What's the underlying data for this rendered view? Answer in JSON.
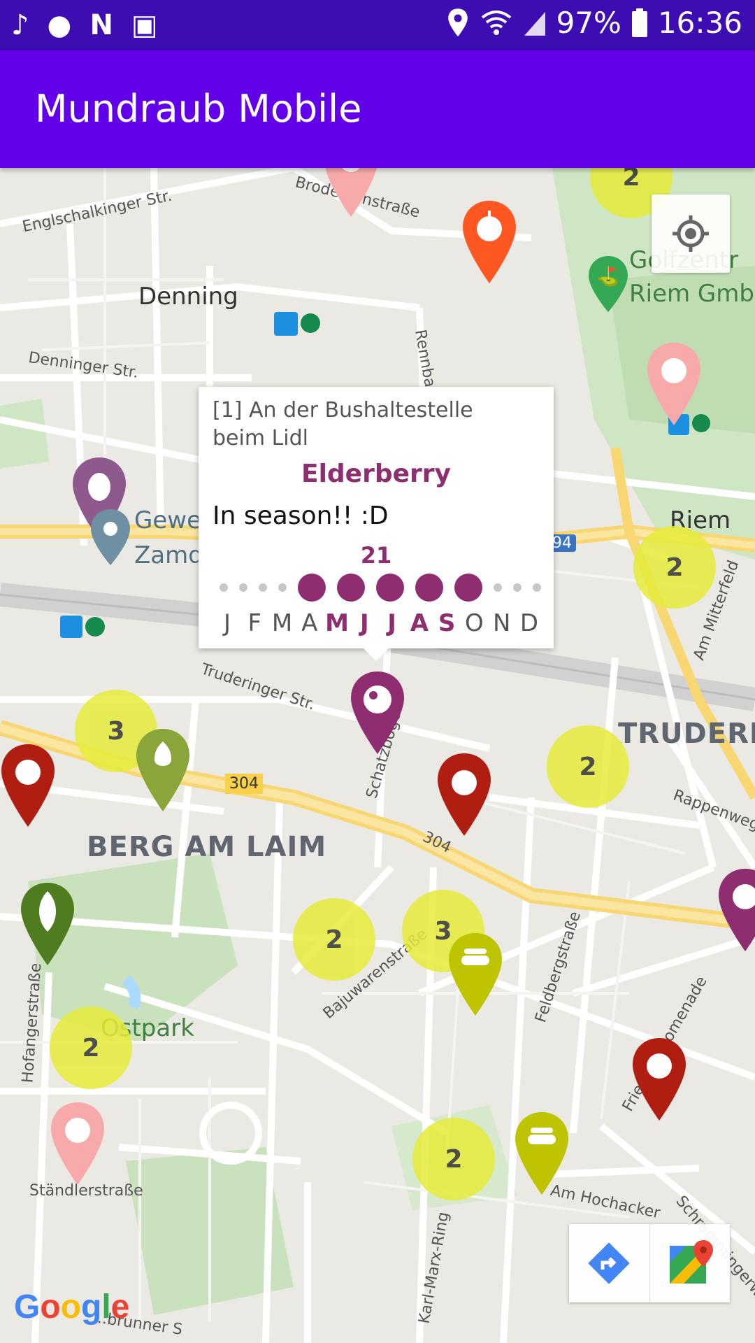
{
  "status_bar": {
    "battery": "97%",
    "time": "16:36",
    "left_icons": [
      "music-note-icon",
      "lightbulb-icon",
      "netflix-icon",
      "gallery-icon"
    ],
    "right_icons": [
      "location-icon",
      "wifi-icon",
      "signal-icon",
      "battery-icon"
    ]
  },
  "app_bar": {
    "title": "Mundraub Mobile"
  },
  "map": {
    "labels": {
      "englschalkinger": "Englschalkinger Str.",
      "brodersen": "Brodersenstraße",
      "denning": "Denning",
      "denninger": "Denninger Str.",
      "rennbahn": "Rennba",
      "golf1": "Golfzentr",
      "golf2": "Riem GmbH",
      "riem": "Riem",
      "gewe": "Gewe",
      "zamd": "Zamd",
      "a94": "94",
      "truderinger": "Truderinger Str.",
      "schatzbogen": "Schatzbogen",
      "trudering": "TRUDERIN",
      "rappenweg": "Rappenweg",
      "am_mitterfeld": "Am Mitterfeld",
      "b304a": "304",
      "b304b": "304",
      "berg": "BERG AM LAIM",
      "hofanger": "Hofangerstraße",
      "bajuwaren": "Bajuwarenstraße",
      "feldberg": "Feldbergstraße",
      "promenade": "Friedenspromenade",
      "ostpark": "Ostpark",
      "staendler": "Ständlerstraße",
      "karl": "Karl-Marx-Ring",
      "hochacker": "Am Hochacker",
      "schramm": "Schrammingerweg",
      "brunner": "...brunner S"
    },
    "clusters": {
      "c1": "2",
      "c2": "2",
      "c3": "3",
      "c4": "2",
      "c5": "2",
      "c6": "3",
      "c7": "2",
      "c8": "2"
    },
    "pin_colors": {
      "orange": "#ff5722",
      "pink": "#f8a9a9",
      "purple": "#8e2d6f",
      "darkred": "#b01e12",
      "olive": "#8aa63a",
      "leaf": "#4f7c1f",
      "yellowgreen": "#bec400",
      "slate": "#6f8fa2"
    }
  },
  "popup": {
    "place": "[1] An der Bushaltestelle beim Lidl",
    "fruit": "Elderberry",
    "season_text": "In season!! :D",
    "count": "21",
    "months": [
      {
        "l": "J",
        "on": false
      },
      {
        "l": "F",
        "on": false
      },
      {
        "l": "M",
        "on": false
      },
      {
        "l": "A",
        "on": false
      },
      {
        "l": "M",
        "on": true
      },
      {
        "l": "J",
        "on": true
      },
      {
        "l": "J",
        "on": true
      },
      {
        "l": "A",
        "on": true
      },
      {
        "l": "S",
        "on": true
      },
      {
        "l": "O",
        "on": false
      },
      {
        "l": "N",
        "on": false
      },
      {
        "l": "D",
        "on": false
      }
    ]
  },
  "controls": {
    "my_location": "my-location-icon",
    "directions": "directions-icon",
    "google_maps": "google-maps-icon"
  },
  "attribution": "Google"
}
